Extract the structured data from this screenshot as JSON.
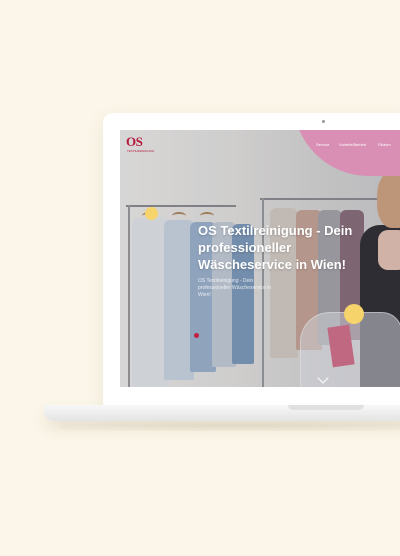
{
  "brand": {
    "logo_text": "OS",
    "logo_tagline": "TEXTILREINIGUNG"
  },
  "nav": {
    "items": [
      {
        "label": "Service"
      },
      {
        "label": "Vorteile/Betrieb"
      },
      {
        "label": "Filialen"
      }
    ]
  },
  "hero": {
    "headline": "OS Textilreinigung - Dein professioneller Wäscheservice in Wien!",
    "subtext": "OS Textilreinigung - Dein professioneller Wäscheservice in Wien!"
  },
  "colors": {
    "background": "#fbf6e9",
    "accent_pink": "#d98eb4",
    "brand_red": "#b3183b",
    "accent_yellow": "#f6d36b"
  },
  "icons": {
    "scroll": "chevron-down-icon"
  }
}
